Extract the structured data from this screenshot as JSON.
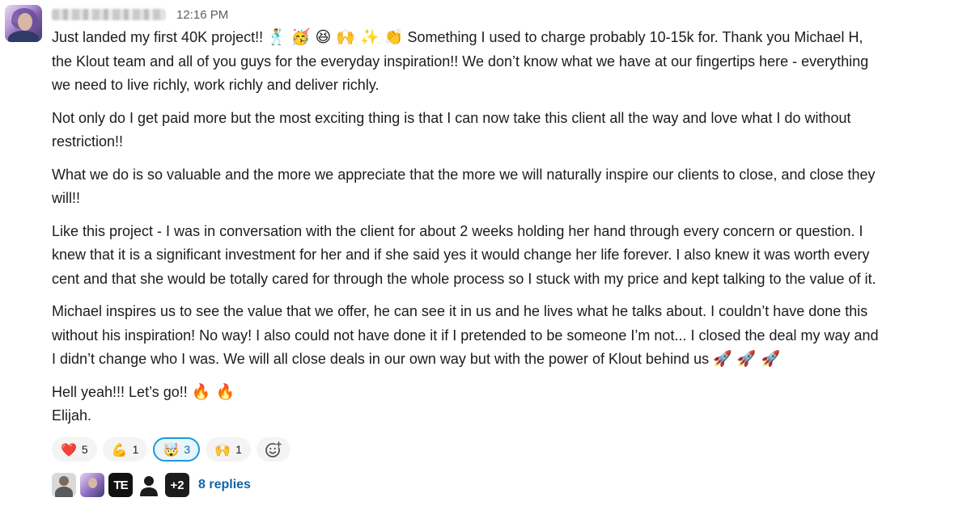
{
  "header": {
    "timestamp": "12:16 PM"
  },
  "message": {
    "p1_text": "Just landed my first 40K project!!",
    "p1_emojis": "🕺 🥳 😆 🙌 ✨ 👏",
    "p1_rest": "Something I used to charge probably 10-15k for. Thank you Michael H,",
    "p1_line2": "the Klout team and all of you guys for the everyday inspiration!! We don’t know what we have at our fingertips here - everything",
    "p1_line3": "we need to live richly, work richly and deliver richly.",
    "p2_line1": "Not only do I get paid more but the most exciting thing is that I can now take this client all the way and love what I do without",
    "p2_line2": "restriction!!",
    "p3_line1": "What we do is so valuable and the more we appreciate that the more we will naturally inspire our clients to close, and close they",
    "p3_line2": "will!!",
    "p4_line1": "Like this project - I was in conversation with the client for about 2 weeks holding her hand through every concern or question. I",
    "p4_line2": "knew that it is a significant investment for her and if she said yes it would change her life forever. I also knew it was worth every",
    "p4_line3": "cent and that she would be totally cared for through the whole process so I stuck with my price and kept talking to the value of it.",
    "p5_line1": "Michael inspires us to see the value that we offer, he can see it in us and he lives what he talks about. I couldn’t have done this",
    "p5_line2": "without his inspiration! No way! I also could not have done it if I pretended to be someone I’m not... I closed the deal my way and",
    "p5_line3": "I didn’t change who I was. We will all close deals in our own way but with the power of Klout behind us",
    "p5_emojis": "🚀 🚀 🚀",
    "p6_text": "Hell yeah!!! Let’s go!!",
    "p6_emojis": "🔥 🔥",
    "signature": "Elijah."
  },
  "reactions": [
    {
      "emoji": "❤️",
      "count": "5",
      "icon": "heart-icon"
    },
    {
      "emoji": "💪",
      "count": "1",
      "icon": "flexed-biceps-icon"
    },
    {
      "emoji": "🤯",
      "count": "3",
      "icon": "mind-blown-icon"
    },
    {
      "emoji": "🙌",
      "count": "1",
      "icon": "raised-hands-icon"
    }
  ],
  "thread": {
    "avatar3_initials": "TE",
    "more_count": "+2",
    "replies_label": "8 replies"
  },
  "colors": {
    "link": "#1264a3",
    "active_reaction_border": "#1d9bd1",
    "text": "#1d1c1d",
    "muted": "#616061"
  }
}
